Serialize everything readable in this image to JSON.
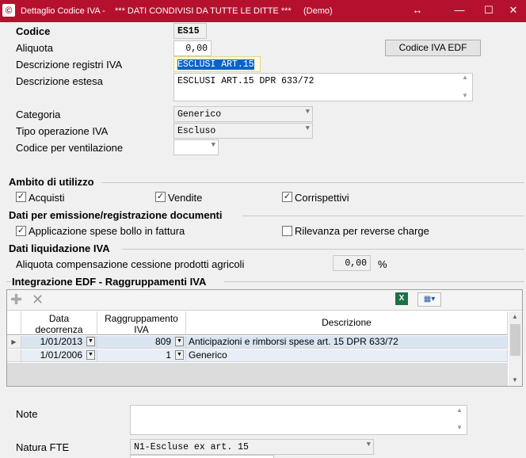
{
  "window": {
    "title": "Dettaglio Codice IVA -    *** DATI CONDIVISI DA TUTTE LE DITTE ***     (Demo)",
    "icon": "app-logo-icon",
    "resize_glyph": "↔",
    "minimize_glyph": "—",
    "maximize_glyph": "☐",
    "close_glyph": "✕"
  },
  "form": {
    "codice_label": "Codice",
    "codice_value": "ES15",
    "aliquota_label": "Aliquota",
    "aliquota_value": "0,00",
    "edf_button": "Codice IVA EDF",
    "descr_registri_label": "Descrizione registri IVA",
    "descr_registri_value": "ESCLUSI ART.15",
    "descr_estesa_label": "Descrizione estesa",
    "descr_estesa_value": "ESCLUSI ART.15 DPR 633/72",
    "categoria_label": "Categoria",
    "categoria_value": "Generico",
    "tipo_op_label": "Tipo operazione IVA",
    "tipo_op_value": "Escluso",
    "codice_vent_label": "Codice per ventilazione",
    "codice_vent_value": ""
  },
  "ambito": {
    "title": "Ambito di utilizzo",
    "acquisti": "Acquisti",
    "acquisti_checked": true,
    "vendite": "Vendite",
    "vendite_checked": true,
    "corrispettivi": "Corrispettivi",
    "corrispettivi_checked": true
  },
  "emissione": {
    "title": "Dati per emissione/registrazione documenti",
    "bollo": "Applicazione spese bollo in fattura",
    "bollo_checked": true,
    "reverse": "Rilevanza per reverse charge",
    "reverse_checked": false
  },
  "liquidazione": {
    "title": "Dati liquidazione IVA",
    "aliquota_comp_label": "Aliquota compensazione cessione prodotti agricoli",
    "aliquota_comp_value": "0,00",
    "percent": "%"
  },
  "edf_grid": {
    "title": "Integrazione EDF - Raggruppamenti IVA",
    "toolbar": [
      "add-icon",
      "delete-icon",
      "excel-export-icon",
      "column-settings-icon"
    ],
    "headers": {
      "data": "Data\ndecorrenza",
      "raggr": "Raggruppamento\nIVA",
      "descr": "Descrizione"
    },
    "rows": [
      {
        "data": "1/01/2013",
        "raggr": "809",
        "descr": "Anticipazioni e rimborsi spese art. 15 DPR 633/72"
      },
      {
        "data": "1/01/2006",
        "raggr": "1",
        "descr": "Generico"
      }
    ]
  },
  "note": {
    "label": "Note",
    "value": ""
  },
  "natura": {
    "label": "Natura FTE",
    "value": "N1-Escluse ex art. 15"
  }
}
